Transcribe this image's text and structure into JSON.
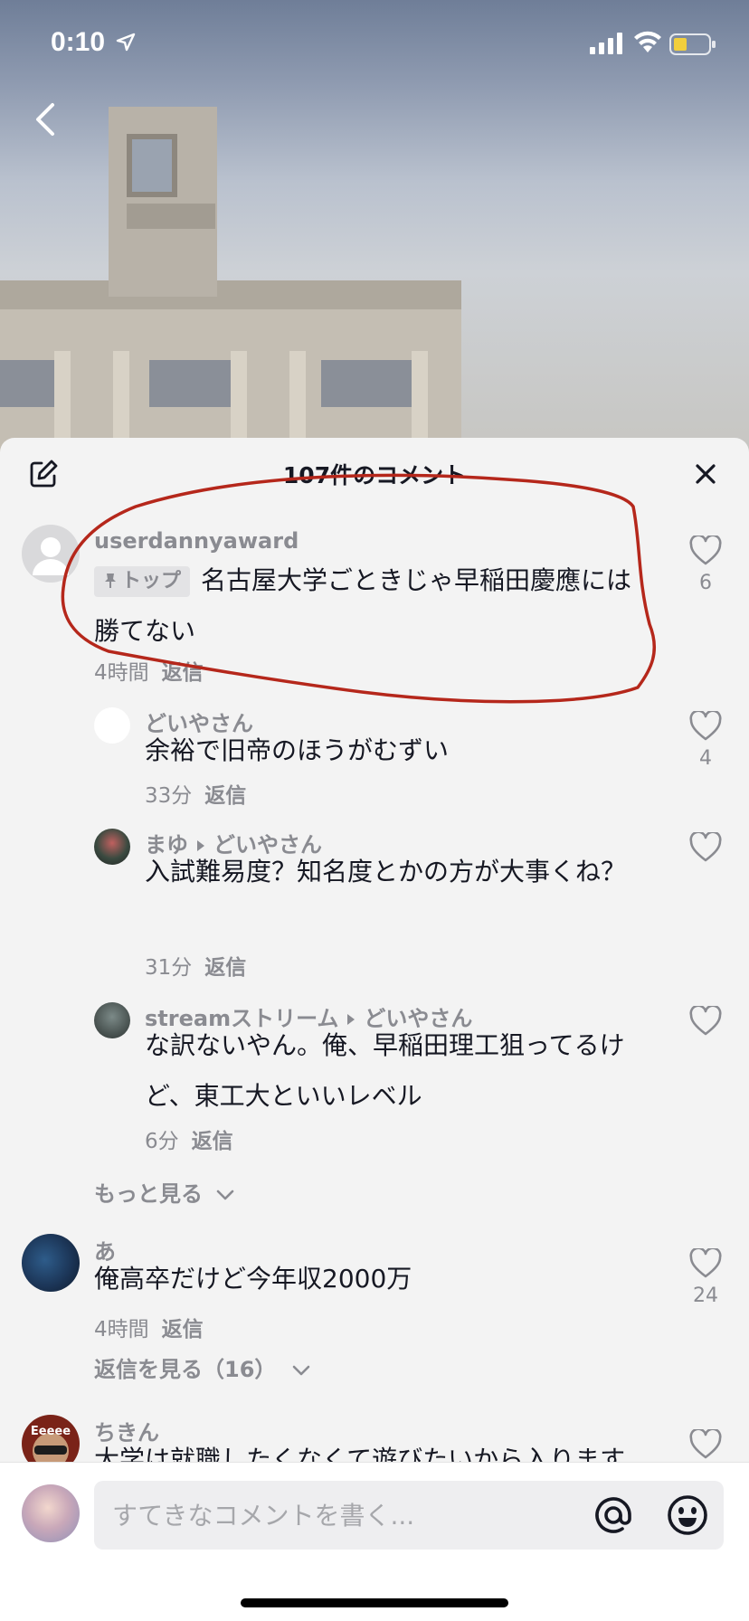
{
  "status_bar": {
    "time": "0:10"
  },
  "sheet": {
    "title": "107件のコメント"
  },
  "comments": [
    {
      "username": "userdannyaward",
      "pin_label": "トップ",
      "text": "名古屋大学ごときじゃ早稲田慶應には勝てない",
      "time": "4時間",
      "reply": "返信",
      "likes": "6"
    },
    {
      "username": "どいやさん",
      "text": "余裕で旧帝のほうがむずい",
      "time": "33分",
      "reply": "返信",
      "likes": "4"
    },
    {
      "username": "まゆ",
      "reply_to": "どいやさん",
      "text": "入試難易度？知名度とかの方が大事くね？",
      "time": "31分",
      "reply": "返信",
      "likes": ""
    },
    {
      "username": "streamストリーム",
      "reply_to": "どいやさん",
      "text": "な訳ないやん。俺、早稲田理工狙ってるけど、東工大といいレベル",
      "time": "6分",
      "reply": "返信",
      "likes": ""
    },
    {
      "username": "あ",
      "text": "俺高卒だけど今年収2000万",
      "time": "4時間",
      "reply": "返信",
      "likes": "24"
    },
    {
      "username": "ちきん",
      "text": "大学は就職したくなくて遊びたいから入ります",
      "time": "",
      "reply": "",
      "likes": ""
    }
  ],
  "more_link": "もっと見る",
  "view_replies": "返信を見る（16）",
  "avatar_badge": "Eeeee",
  "input": {
    "placeholder": "すてきなコメントを書く..."
  },
  "colors": {
    "text_primary": "#161823",
    "text_secondary": "#8a8b91",
    "annotation": "#b5271b"
  }
}
